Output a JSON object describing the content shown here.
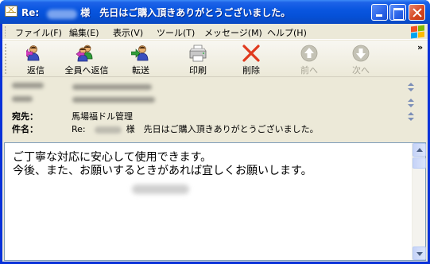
{
  "window": {
    "title_prefix": "Re:",
    "title_suffix": "様　先日はご購入頂きありがとうございました。"
  },
  "menu": [
    "ファイル(F)",
    "編集(E)",
    "表示(V)",
    "ツール(T)",
    "メッセージ(M)",
    "ヘルプ(H)"
  ],
  "toolbar": {
    "reply": "返信",
    "reply_all": "全員へ返信",
    "forward": "転送",
    "print": "印刷",
    "delete": "削除",
    "previous": "前へ",
    "next": "次へ",
    "overflow": "»"
  },
  "headers": {
    "to_label": "宛先：",
    "to_value": "馬場福ドル管理",
    "subject_label": "件名：",
    "subject_prefix": "Re:",
    "subject_suffix": "様　先日はご購入頂きありがとうございました。"
  },
  "body": {
    "line1": "ご丁寧な対応に安心して使用できます。",
    "line2": "今後、また、お願いするときがあれば宜しくお願いします。"
  },
  "colors": {
    "titlebar": "#0550d6",
    "client": "#ece9d8",
    "delete_x": "#e03a1e"
  }
}
